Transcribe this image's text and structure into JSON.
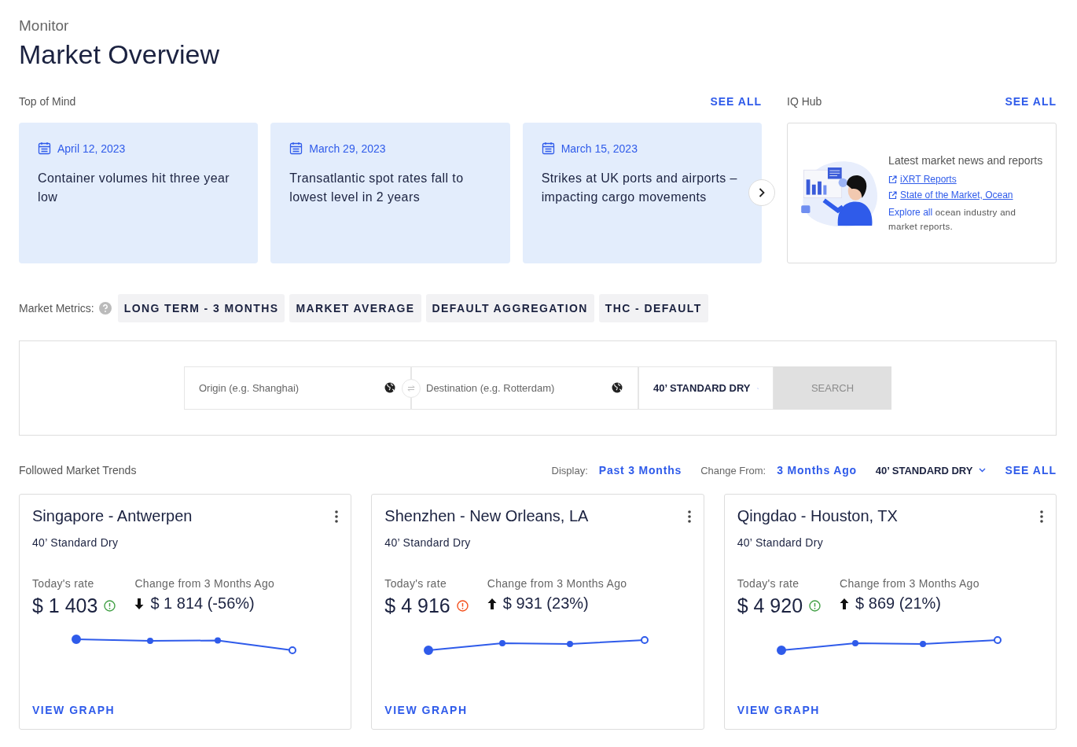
{
  "header": {
    "eyebrow": "Monitor",
    "title": "Market Overview"
  },
  "top_of_mind": {
    "title": "Top of Mind",
    "see_all": "SEE ALL",
    "cards": [
      {
        "date": "April 12, 2023",
        "headline": "Container volumes hit three year low"
      },
      {
        "date": "March 29, 2023",
        "headline": "Transatlantic spot rates fall to lowest level in 2 years"
      },
      {
        "date": "March 15, 2023",
        "headline": "Strikes at UK ports and airports – impacting cargo movements"
      }
    ]
  },
  "iq_hub": {
    "title": "IQ Hub",
    "see_all": "SEE ALL",
    "heading": "Latest market news and reports",
    "links": [
      "iXRT Reports",
      "State of the Market, Ocean"
    ],
    "explore_link": "Explore all",
    "explore_text": " ocean industry and market reports."
  },
  "market_metrics": {
    "label": "Market Metrics:",
    "chips": [
      "LONG TERM - 3 MONTHS",
      "MARKET AVERAGE",
      "DEFAULT AGGREGATION",
      "THC - DEFAULT"
    ]
  },
  "search": {
    "origin_placeholder": "Origin (e.g. Shanghai)",
    "destination_placeholder": "Destination (e.g. Rotterdam)",
    "container": "40’ STANDARD DRY",
    "button": "SEARCH",
    "button_disabled": true
  },
  "trends": {
    "title": "Followed Market Trends",
    "display_label": "Display:",
    "display_value": "Past 3 Months",
    "change_label": "Change From:",
    "change_value": "3 Months Ago",
    "container": "40’ STANDARD DRY",
    "see_all": "SEE ALL",
    "cards": [
      {
        "route": "Singapore - Antwerpen",
        "container": "40’ Standard Dry",
        "rate_label": "Today's rate",
        "rate": "$ 1 403",
        "color": "#43a047",
        "change_label": "Change from 3 Months Ago",
        "kind": "down",
        "change": "$ 1 814 (-56%)",
        "link": "VIEW GRAPH"
      },
      {
        "route": "Shenzhen - New Orleans, LA",
        "container": "40’ Standard Dry",
        "rate_label": "Today's rate",
        "rate": "$ 4 916",
        "color": "#f4511e",
        "change_label": "Change from 3 Months Ago",
        "kind": "up",
        "change": "$ 931 (23%)",
        "link": "VIEW GRAPH"
      },
      {
        "route": "Qingdao - Houston, TX",
        "container": "40’ Standard Dry",
        "rate_label": "Today's rate",
        "rate": "$ 4 920",
        "color": "#43a047",
        "change_label": "Change from 3 Months Ago",
        "kind": "up",
        "change": "$ 869 (21%)",
        "link": "VIEW GRAPH"
      }
    ]
  }
}
